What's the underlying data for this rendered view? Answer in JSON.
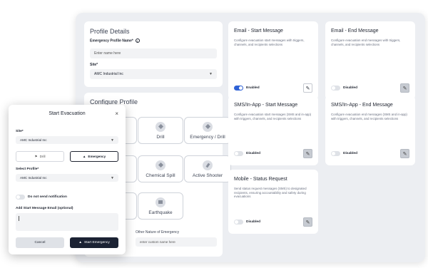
{
  "profile_details": {
    "title": "Profile Details",
    "name_label": "Emergency Profile Name*",
    "name_placeholder": "Enter name here",
    "site_label": "Site*",
    "site_value": "AMC Industrial Inc"
  },
  "configure_profile": {
    "title": "Configure Profile",
    "tiles": [
      {
        "label": "Drill",
        "icon": "tag-icon"
      },
      {
        "label": "Emergency / Drill",
        "icon": "tag-icon"
      },
      {
        "label": "Chemical Spill",
        "icon": "tag-icon"
      },
      {
        "label": "Active Shooter",
        "icon": "pin-icon"
      },
      {
        "label": "Earthquake",
        "icon": "building-icon"
      }
    ],
    "other_label": "Other Nature of Emergency",
    "other_placeholder": "enter custom name here"
  },
  "message_cards": [
    {
      "title": "Email - Start Message",
      "desc": "Configure evacuation start messages with triggers, channels, and recipients selections",
      "status": "Enabled",
      "enabled": true
    },
    {
      "title": "Email - End Message",
      "desc": "Configure evacuation end messages with triggers, channels, and recipients selections",
      "status": "Disabled",
      "enabled": false
    },
    {
      "title": "SMS/In-App - Start Message",
      "desc": "Configure evacuation start messages (SMS and in-app) with triggers, channels, and recipients selections",
      "status": "Disabled",
      "enabled": false
    },
    {
      "title": "SMS/In-App - End Message",
      "desc": "Configure evacuation end messages (SMS and in-app) with triggers, channels, and recipients selections",
      "status": "Disabled",
      "enabled": false
    },
    {
      "title": "Mobile - Status Request",
      "desc": "Send status request messages (SMS) to designated recipients, ensuring accountability and safety during evacuations",
      "status": "Disabled",
      "enabled": false
    }
  ],
  "modal": {
    "title": "Start Evacuation",
    "close": "×",
    "site_label": "Site*",
    "site_value": "AMC Industrial Inc",
    "drill_label": "Drill",
    "emergency_label": "Emergency",
    "profile_label": "Select Profile*",
    "profile_value": "AMC Industrial Inc",
    "notify_label": "Do not send notification",
    "email_label": "Add Start Message Email (optional)",
    "cancel_label": "Cancel",
    "start_label": "Start Emergency"
  },
  "colors": {
    "accent": "#2f62d6",
    "dark_button": "#1b2233",
    "frame": "#eceef2"
  }
}
